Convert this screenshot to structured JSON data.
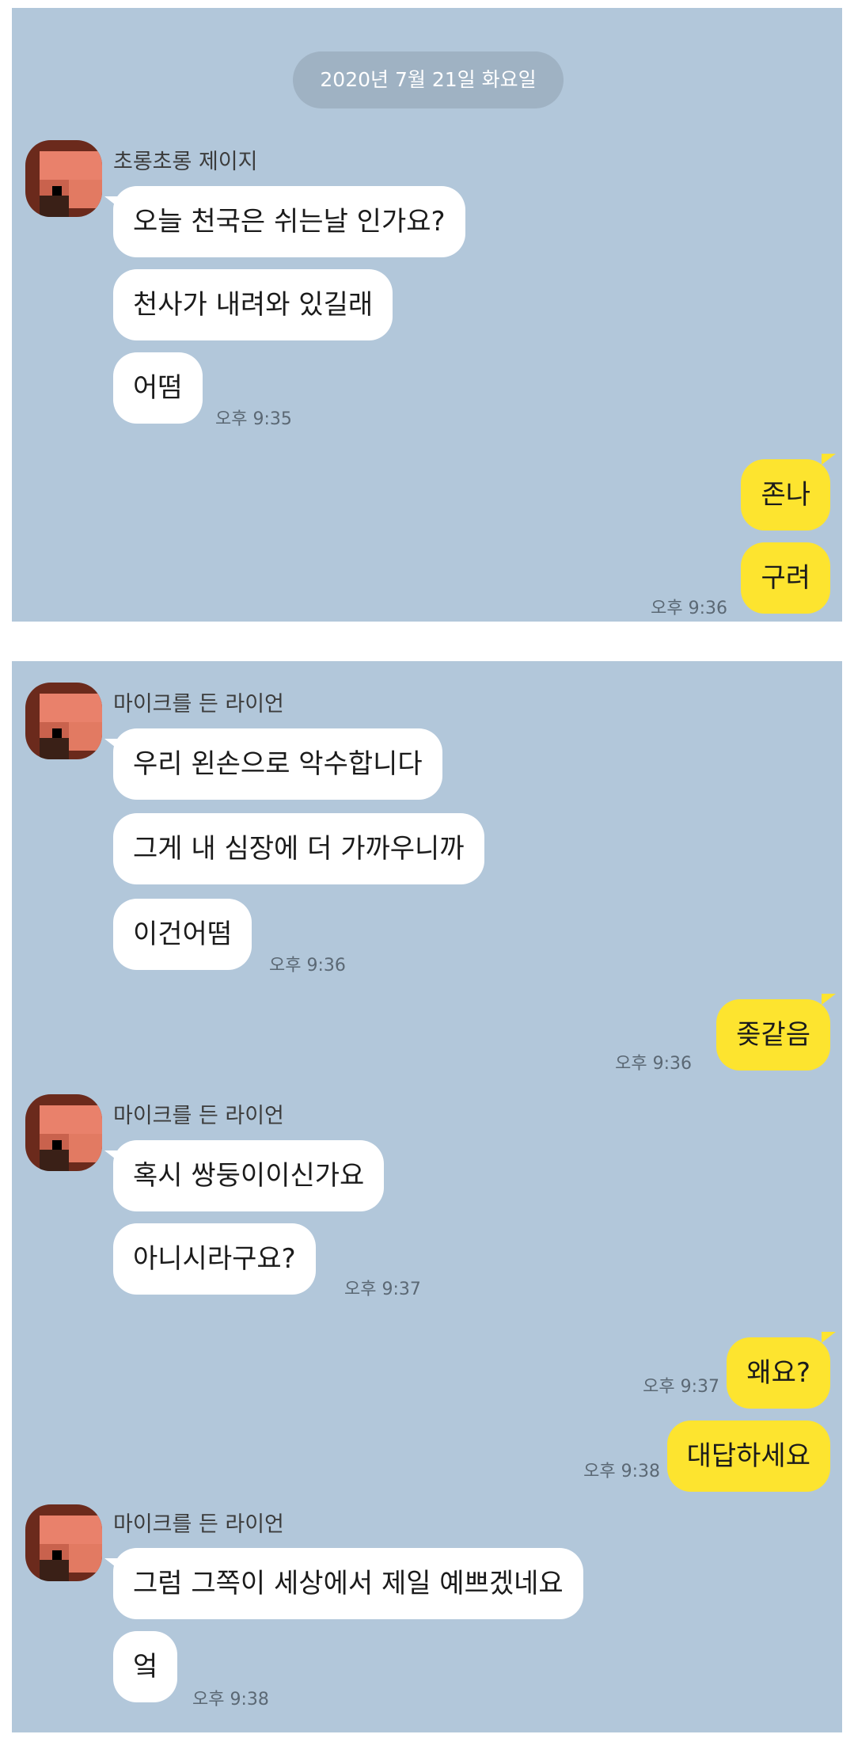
{
  "panel1": {
    "date": "2020년 7월 21일 화요일",
    "sender": "초롱초롱 제이지",
    "incoming": [
      "오늘 천국은 쉬는날 인가요?",
      "천사가 내려와 있길래",
      "어떰"
    ],
    "incoming_time": "오후 9:35",
    "outgoing": [
      "존나",
      "구려"
    ],
    "outgoing_time": "오후 9:36"
  },
  "panel2": {
    "group1": {
      "sender": "마이크를 든 라이언",
      "messages": [
        "우리 왼손으로 악수합니다",
        "그게 내 심장에 더 가까우니까",
        "이건어떰"
      ],
      "time": "오후 9:36"
    },
    "reply1": {
      "text": "좆같음",
      "time": "오후 9:36"
    },
    "group2": {
      "sender": "마이크를 든 라이언",
      "messages": [
        "혹시 쌍둥이이신가요",
        "아니시라구요?"
      ],
      "time": "오후 9:37"
    },
    "reply2": {
      "text": "왜요?",
      "time": "오후 9:37"
    },
    "reply3": {
      "text": "대답하세요",
      "time": "오후 9:38"
    },
    "group3": {
      "sender": "마이크를 든 라이언",
      "messages": [
        "그럼 그쪽이 세상에서 제일 예쁘겠네요",
        "엌"
      ],
      "time": "오후 9:38"
    }
  },
  "colors": {
    "chat_background": "#b2c7da",
    "incoming_bubble": "#ffffff",
    "outgoing_bubble": "#fde42f",
    "date_pill": "#9fb2c3"
  },
  "icons": {
    "avatar": "pixelated-profile-avatar"
  }
}
